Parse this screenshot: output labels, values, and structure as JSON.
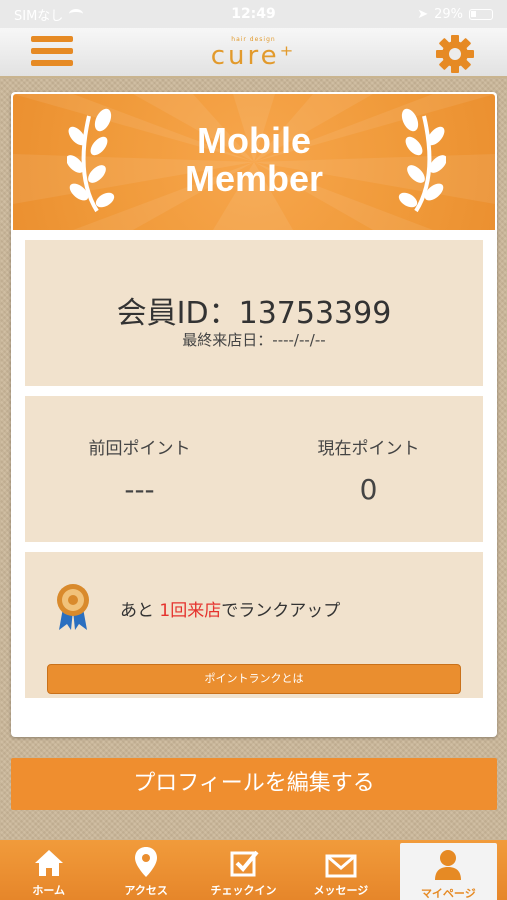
{
  "status_bar": {
    "carrier": "SIMなし",
    "time": "12:49",
    "battery": "29%"
  },
  "header": {
    "logo_sub": "hair design",
    "logo_main": "cure⁺"
  },
  "banner": {
    "title_line1": "Mobile",
    "title_line2": "Member"
  },
  "member": {
    "id_text": "会員ID：13753399",
    "last_visit": "最終来店日：----/--/--"
  },
  "points": {
    "previous_label": "前回ポイント",
    "previous_value": "---",
    "current_label": "現在ポイント",
    "current_value": "0"
  },
  "rank": {
    "text_prefix": "あと ",
    "text_highlight": "1回来店",
    "text_suffix": "でランクアップ",
    "button_label": "ポイントランクとは"
  },
  "profile_button": "プロフィールを編集する",
  "tabs": [
    {
      "label": "ホーム",
      "icon": "home-icon"
    },
    {
      "label": "アクセス",
      "icon": "map-pin-icon"
    },
    {
      "label": "チェックイン",
      "icon": "checkin-icon"
    },
    {
      "label": "メッセージ",
      "icon": "mail-icon"
    },
    {
      "label": "マイページ",
      "icon": "person-icon",
      "active": true
    }
  ],
  "colors": {
    "accent": "#ef8e2f",
    "panel": "#f1e2cd",
    "highlight": "#e5322d"
  }
}
